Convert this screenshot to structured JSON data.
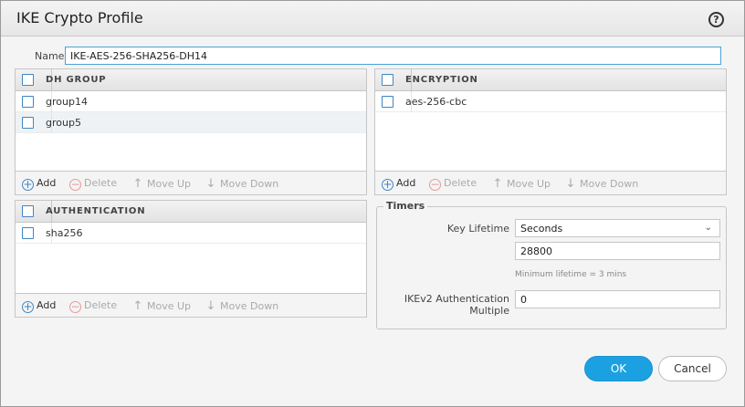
{
  "dialog": {
    "title": "IKE Crypto Profile",
    "help": "?"
  },
  "name": {
    "label": "Name",
    "value": "IKE-AES-256-SHA256-DH14"
  },
  "dh_group": {
    "header": "DH GROUP",
    "rows": [
      "group14",
      "group5"
    ]
  },
  "encryption": {
    "header": "ENCRYPTION",
    "rows": [
      "aes-256-cbc"
    ]
  },
  "authentication": {
    "header": "AUTHENTICATION",
    "rows": [
      "sha256"
    ]
  },
  "toolbar": {
    "add": "Add",
    "delete": "Delete",
    "move_up": "Move Up",
    "move_down": "Move Down"
  },
  "timers": {
    "legend": "Timers",
    "key_lifetime_label": "Key Lifetime",
    "key_lifetime_unit": "Seconds",
    "key_lifetime_value": "28800",
    "key_lifetime_hint": "Minimum lifetime = 3 mins",
    "ikev2_label_line1": "IKEv2 Authentication",
    "ikev2_label_line2": "Multiple",
    "ikev2_value": "0"
  },
  "buttons": {
    "ok": "OK",
    "cancel": "Cancel"
  },
  "colors": {
    "accent": "#1ba1e2",
    "checkbox": "#3f86c4"
  }
}
